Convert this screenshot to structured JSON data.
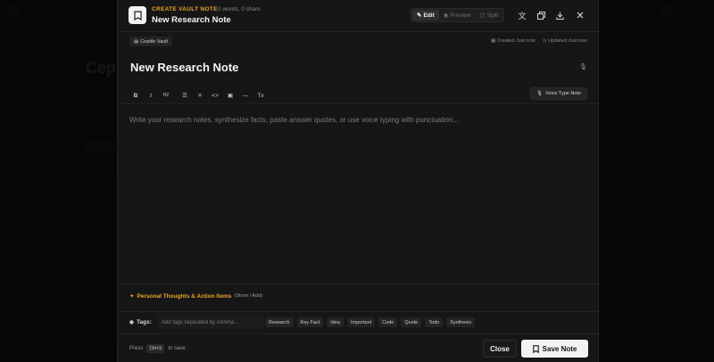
{
  "header": {
    "kicker": "CREATE VAULT NOTE",
    "stats": "0 words, 0 chars",
    "title": "New Research Note",
    "modes": {
      "edit": "Edit",
      "preview": "Preview",
      "split": "Split"
    },
    "icons": [
      "note-icon",
      "translate-icon",
      "copy-icon",
      "download-icon",
      "close-icon"
    ]
  },
  "meta": {
    "vault": "Ceptile Vault",
    "created": "Created Just now",
    "updated": "Updated Just now"
  },
  "document": {
    "title": "New Research Note",
    "placeholder": "Write your research notes, synthesize facts, paste answer quotes, or use voice typing with punctuation..."
  },
  "toolbar": {
    "buttons": [
      "bold",
      "italic",
      "heading",
      "bullet-list",
      "numbered-list",
      "code",
      "image",
      "divider",
      "clear-format"
    ],
    "heading_label": "H2",
    "voice_label": "Voice Type Note"
  },
  "thoughts": {
    "label": "Personal Thoughts & Action Items",
    "hint": "(Show / Add)"
  },
  "tags": {
    "label": "Tags:",
    "placeholder": "Add tags separated by comma...",
    "chips": [
      "Research",
      "Key Fact",
      "Idea",
      "Important",
      "Code",
      "Quote",
      "Todo",
      "Synthesis"
    ]
  },
  "footer": {
    "press": "Press",
    "shortcut": "Ctrl+S",
    "to_save": "to save",
    "close_label": "Close",
    "save_label": "Save Note"
  },
  "colors": {
    "accent": "#e8a628",
    "modal_bg": "#161617",
    "save_bg": "#f2f2f2"
  }
}
